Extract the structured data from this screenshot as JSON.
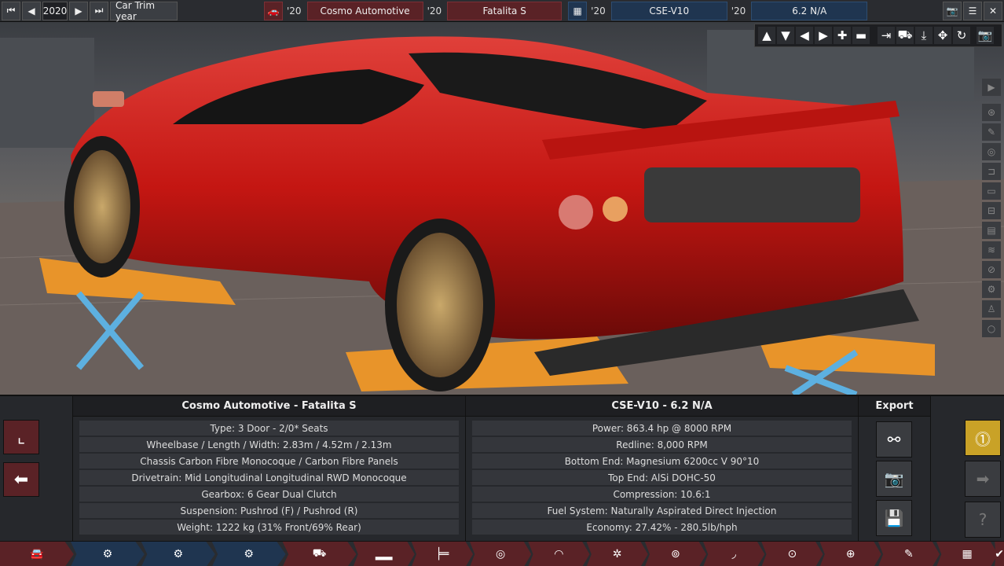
{
  "topbar": {
    "trim_year": "2020",
    "trim_label": "Car Trim year",
    "model_year": "'20",
    "company": "Cosmo Automotive",
    "model_name_year": "'20",
    "model_name": "Fatalita S",
    "engine_family_year": "'20",
    "engine_family": "CSE-V10",
    "engine_variant_year": "'20",
    "engine_variant": "6.2 N/A"
  },
  "car_panel": {
    "title": "Cosmo Automotive - Fatalita S",
    "rows": [
      "Type: 3 Door - 2/0* Seats",
      "Wheelbase / Length / Width: 2.83m / 4.52m / 2.13m",
      "Chassis Carbon Fibre Monocoque / Carbon Fibre Panels",
      "Drivetrain: Mid Longitudinal Longitudinal RWD Monocoque",
      "Gearbox: 6 Gear Dual Clutch",
      "Suspension: Pushrod (F) / Pushrod (R)",
      "Weight: 1222 kg (31% Front/69% Rear)"
    ]
  },
  "engine_panel": {
    "title": "CSE-V10 - 6.2 N/A",
    "rows": [
      "Power: 863.4 hp @ 8000 RPM",
      "Redline:  8,000 RPM",
      "Bottom End: Magnesium 6200cc V 90°10",
      "Top End: AlSi DOHC-50",
      "Compression: 10.6:1",
      "Fuel System: Naturally Aspirated Direct Injection",
      "Economy: 27.42% - 280.5lb/hph"
    ]
  },
  "export": {
    "title": "Export"
  },
  "colors": {
    "accent_red": "#5a2226",
    "accent_blue": "#1f3550",
    "warning_yellow": "#c9a227",
    "car_paint": "#c41612"
  }
}
